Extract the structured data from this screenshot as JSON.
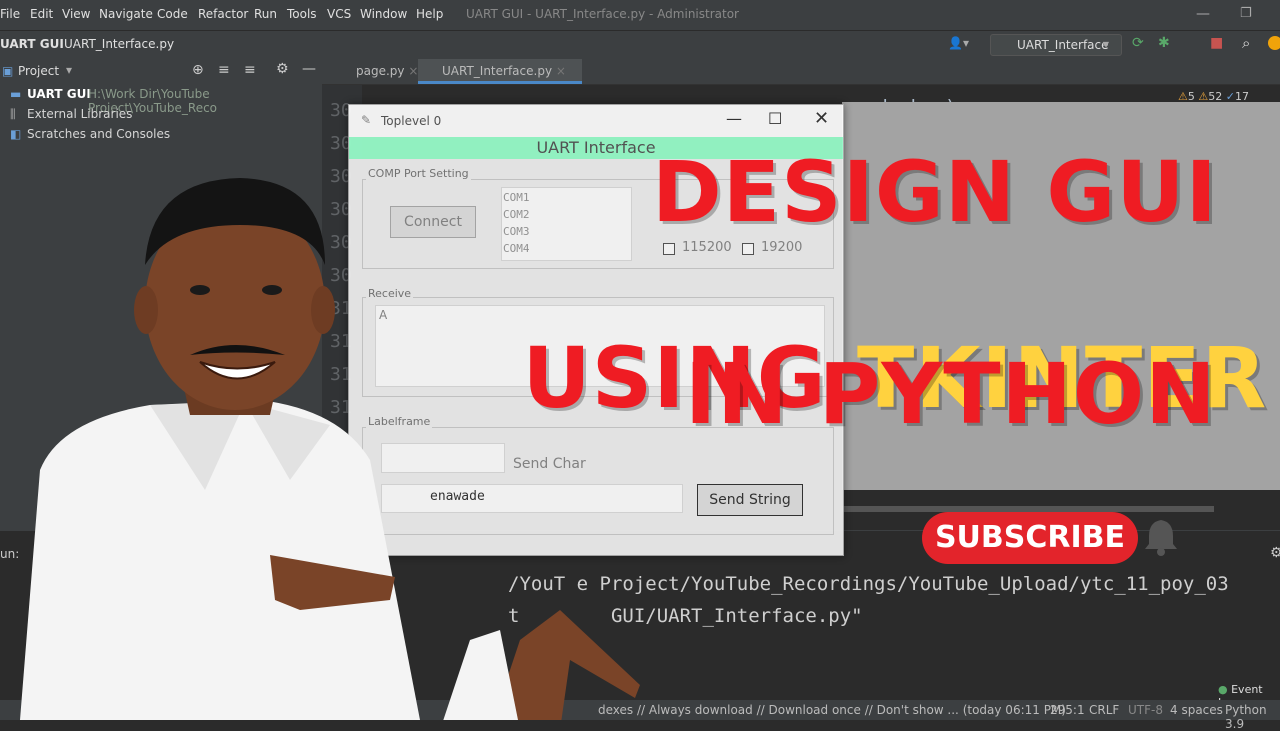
{
  "menu": [
    "File",
    "Edit",
    "View",
    "Navigate",
    "Code",
    "Refactor",
    "Run",
    "Tools",
    "VCS",
    "Window",
    "Help"
  ],
  "window_title": "UART GUI - UART_Interface.py - Administrator",
  "breadcrumb": {
    "project": "UART GUI",
    "file": "UART_Interface.py"
  },
  "run_config": "UART_Interface",
  "project_panel": {
    "title": "Project",
    "root": "UART GUI",
    "root_path": "H:\\Work Dir\\YouTube Project\\YouTube_Reco",
    "items": [
      "External Libraries",
      "Scratches and Consoles"
    ]
  },
  "tabs": [
    "page.py",
    "UART_Interface.py"
  ],
  "code_line": "send_char)",
  "inspections": {
    "errors": "5",
    "warnings": "52",
    "weak": "17"
  },
  "line_numbers": [
    "30",
    "30",
    "30",
    "30",
    "30",
    "30",
    "31",
    "31",
    "31",
    "31",
    "31"
  ],
  "tk": {
    "title": "Toplevel 0",
    "header": "UART Interface",
    "port_frame": "COMP Port Setting",
    "connect": "Connect",
    "ports": [
      "COM1",
      "COM2",
      "COM3",
      "COM4"
    ],
    "baud_opts": [
      "115200",
      "19200"
    ],
    "receive_frame": "Receive",
    "receive_text": "A",
    "label_frame": "Labelframe",
    "send_char": "Send Char",
    "string_value": "enawade",
    "send_string": "Send String"
  },
  "overlay": {
    "line1": "DESIGN GUI",
    "line2a": "USING ",
    "line2b": "TKINTER",
    "line3": "IN PYTHON",
    "subscribe": "SUBSCRIBE",
    "colors": {
      "red": "#ef1c23",
      "yellow": "#ffd23f"
    }
  },
  "run_panel": {
    "label": "un:",
    "line1": "/YouT  e Project/YouTube_Recordings/YouTube_Upload/ytc_11_poy_03",
    "line2": "t        GUI/UART_Interface.py\""
  },
  "status": {
    "message": "dexes // Always download // Download once // Don't show ... (today 06:11 PM)",
    "position": "295:1",
    "line_sep": "CRLF",
    "encoding": "UTF-8",
    "indent": "4 spaces",
    "interpreter": "Python 3.9",
    "event_log": "Event Log"
  }
}
